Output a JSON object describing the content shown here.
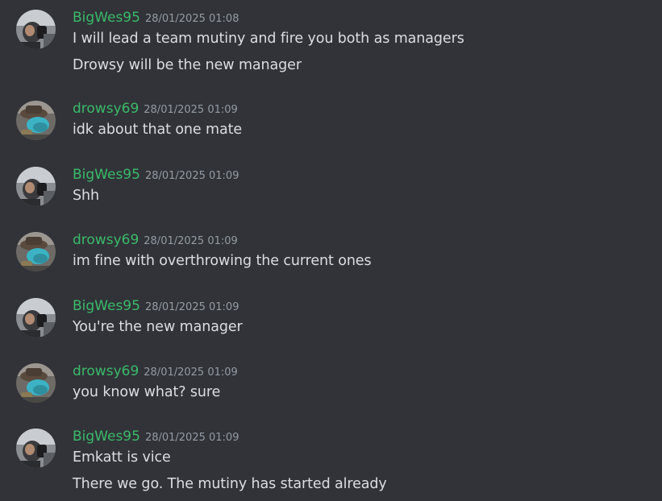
{
  "colors": {
    "background": "#313338",
    "username": "#3aba6a",
    "timestamp": "#949ba4",
    "message_text": "#dbdee1"
  },
  "messages": [
    {
      "author": "BigWes95",
      "avatar": "bigwes95-avatar",
      "timestamp": "28/01/2025 01:08",
      "lines": [
        "I will lead a team mutiny and fire you both as managers",
        "Drowsy will be the new manager"
      ]
    },
    {
      "author": "drowsy69",
      "avatar": "drowsy69-avatar",
      "timestamp": "28/01/2025 01:09",
      "lines": [
        "idk about that one mate"
      ]
    },
    {
      "author": "BigWes95",
      "avatar": "bigwes95-avatar",
      "timestamp": "28/01/2025 01:09",
      "lines": [
        "Shh"
      ]
    },
    {
      "author": "drowsy69",
      "avatar": "drowsy69-avatar",
      "timestamp": "28/01/2025 01:09",
      "lines": [
        "im fine with overthrowing the current ones"
      ]
    },
    {
      "author": "BigWes95",
      "avatar": "bigwes95-avatar",
      "timestamp": "28/01/2025 01:09",
      "lines": [
        "You're the new manager"
      ]
    },
    {
      "author": "drowsy69",
      "avatar": "drowsy69-avatar",
      "timestamp": "28/01/2025 01:09",
      "lines": [
        "you know what? sure"
      ]
    },
    {
      "author": "BigWes95",
      "avatar": "bigwes95-avatar",
      "timestamp": "28/01/2025 01:09",
      "lines": [
        "Emkatt is vice",
        "There we go. The mutiny has started already"
      ]
    }
  ]
}
